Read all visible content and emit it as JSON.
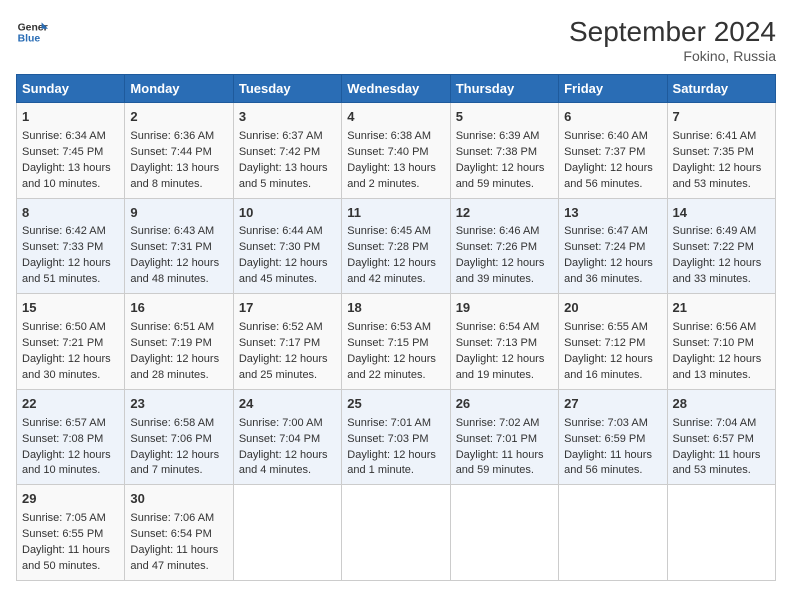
{
  "header": {
    "logo_line1": "General",
    "logo_line2": "Blue",
    "month": "September 2024",
    "location": "Fokino, Russia"
  },
  "weekdays": [
    "Sunday",
    "Monday",
    "Tuesday",
    "Wednesday",
    "Thursday",
    "Friday",
    "Saturday"
  ],
  "weeks": [
    [
      {
        "day": "1",
        "lines": [
          "Sunrise: 6:34 AM",
          "Sunset: 7:45 PM",
          "Daylight: 13 hours",
          "and 10 minutes."
        ]
      },
      {
        "day": "2",
        "lines": [
          "Sunrise: 6:36 AM",
          "Sunset: 7:44 PM",
          "Daylight: 13 hours",
          "and 8 minutes."
        ]
      },
      {
        "day": "3",
        "lines": [
          "Sunrise: 6:37 AM",
          "Sunset: 7:42 PM",
          "Daylight: 13 hours",
          "and 5 minutes."
        ]
      },
      {
        "day": "4",
        "lines": [
          "Sunrise: 6:38 AM",
          "Sunset: 7:40 PM",
          "Daylight: 13 hours",
          "and 2 minutes."
        ]
      },
      {
        "day": "5",
        "lines": [
          "Sunrise: 6:39 AM",
          "Sunset: 7:38 PM",
          "Daylight: 12 hours",
          "and 59 minutes."
        ]
      },
      {
        "day": "6",
        "lines": [
          "Sunrise: 6:40 AM",
          "Sunset: 7:37 PM",
          "Daylight: 12 hours",
          "and 56 minutes."
        ]
      },
      {
        "day": "7",
        "lines": [
          "Sunrise: 6:41 AM",
          "Sunset: 7:35 PM",
          "Daylight: 12 hours",
          "and 53 minutes."
        ]
      }
    ],
    [
      {
        "day": "8",
        "lines": [
          "Sunrise: 6:42 AM",
          "Sunset: 7:33 PM",
          "Daylight: 12 hours",
          "and 51 minutes."
        ]
      },
      {
        "day": "9",
        "lines": [
          "Sunrise: 6:43 AM",
          "Sunset: 7:31 PM",
          "Daylight: 12 hours",
          "and 48 minutes."
        ]
      },
      {
        "day": "10",
        "lines": [
          "Sunrise: 6:44 AM",
          "Sunset: 7:30 PM",
          "Daylight: 12 hours",
          "and 45 minutes."
        ]
      },
      {
        "day": "11",
        "lines": [
          "Sunrise: 6:45 AM",
          "Sunset: 7:28 PM",
          "Daylight: 12 hours",
          "and 42 minutes."
        ]
      },
      {
        "day": "12",
        "lines": [
          "Sunrise: 6:46 AM",
          "Sunset: 7:26 PM",
          "Daylight: 12 hours",
          "and 39 minutes."
        ]
      },
      {
        "day": "13",
        "lines": [
          "Sunrise: 6:47 AM",
          "Sunset: 7:24 PM",
          "Daylight: 12 hours",
          "and 36 minutes."
        ]
      },
      {
        "day": "14",
        "lines": [
          "Sunrise: 6:49 AM",
          "Sunset: 7:22 PM",
          "Daylight: 12 hours",
          "and 33 minutes."
        ]
      }
    ],
    [
      {
        "day": "15",
        "lines": [
          "Sunrise: 6:50 AM",
          "Sunset: 7:21 PM",
          "Daylight: 12 hours",
          "and 30 minutes."
        ]
      },
      {
        "day": "16",
        "lines": [
          "Sunrise: 6:51 AM",
          "Sunset: 7:19 PM",
          "Daylight: 12 hours",
          "and 28 minutes."
        ]
      },
      {
        "day": "17",
        "lines": [
          "Sunrise: 6:52 AM",
          "Sunset: 7:17 PM",
          "Daylight: 12 hours",
          "and 25 minutes."
        ]
      },
      {
        "day": "18",
        "lines": [
          "Sunrise: 6:53 AM",
          "Sunset: 7:15 PM",
          "Daylight: 12 hours",
          "and 22 minutes."
        ]
      },
      {
        "day": "19",
        "lines": [
          "Sunrise: 6:54 AM",
          "Sunset: 7:13 PM",
          "Daylight: 12 hours",
          "and 19 minutes."
        ]
      },
      {
        "day": "20",
        "lines": [
          "Sunrise: 6:55 AM",
          "Sunset: 7:12 PM",
          "Daylight: 12 hours",
          "and 16 minutes."
        ]
      },
      {
        "day": "21",
        "lines": [
          "Sunrise: 6:56 AM",
          "Sunset: 7:10 PM",
          "Daylight: 12 hours",
          "and 13 minutes."
        ]
      }
    ],
    [
      {
        "day": "22",
        "lines": [
          "Sunrise: 6:57 AM",
          "Sunset: 7:08 PM",
          "Daylight: 12 hours",
          "and 10 minutes."
        ]
      },
      {
        "day": "23",
        "lines": [
          "Sunrise: 6:58 AM",
          "Sunset: 7:06 PM",
          "Daylight: 12 hours",
          "and 7 minutes."
        ]
      },
      {
        "day": "24",
        "lines": [
          "Sunrise: 7:00 AM",
          "Sunset: 7:04 PM",
          "Daylight: 12 hours",
          "and 4 minutes."
        ]
      },
      {
        "day": "25",
        "lines": [
          "Sunrise: 7:01 AM",
          "Sunset: 7:03 PM",
          "Daylight: 12 hours",
          "and 1 minute."
        ]
      },
      {
        "day": "26",
        "lines": [
          "Sunrise: 7:02 AM",
          "Sunset: 7:01 PM",
          "Daylight: 11 hours",
          "and 59 minutes."
        ]
      },
      {
        "day": "27",
        "lines": [
          "Sunrise: 7:03 AM",
          "Sunset: 6:59 PM",
          "Daylight: 11 hours",
          "and 56 minutes."
        ]
      },
      {
        "day": "28",
        "lines": [
          "Sunrise: 7:04 AM",
          "Sunset: 6:57 PM",
          "Daylight: 11 hours",
          "and 53 minutes."
        ]
      }
    ],
    [
      {
        "day": "29",
        "lines": [
          "Sunrise: 7:05 AM",
          "Sunset: 6:55 PM",
          "Daylight: 11 hours",
          "and 50 minutes."
        ]
      },
      {
        "day": "30",
        "lines": [
          "Sunrise: 7:06 AM",
          "Sunset: 6:54 PM",
          "Daylight: 11 hours",
          "and 47 minutes."
        ]
      },
      {
        "day": "",
        "lines": []
      },
      {
        "day": "",
        "lines": []
      },
      {
        "day": "",
        "lines": []
      },
      {
        "day": "",
        "lines": []
      },
      {
        "day": "",
        "lines": []
      }
    ]
  ]
}
